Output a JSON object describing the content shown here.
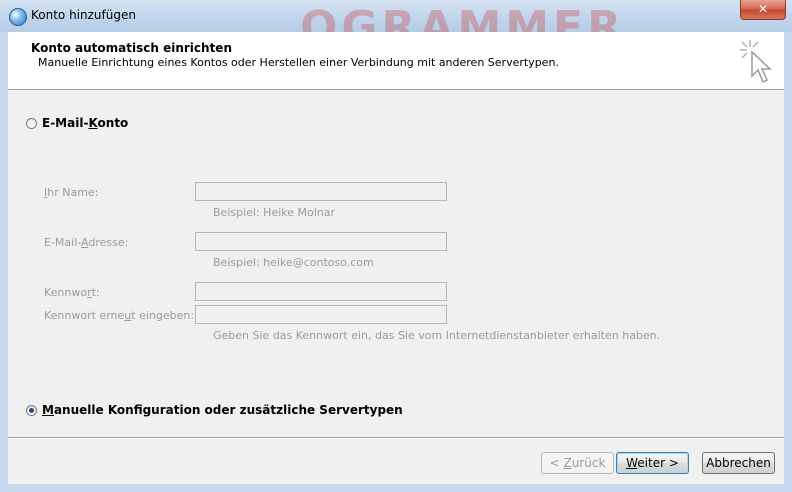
{
  "window": {
    "title": "Konto hinzufügen",
    "background_text": "OGRAMMER",
    "close_symbol": "✕",
    "accent_color": "#c34a30"
  },
  "header": {
    "title": "Konto automatisch einrichten",
    "subtitle": "Manuelle Einrichtung eines Kontos oder Herstellen einer Verbindung mit anderen Servertypen.",
    "icon": "wizard-cursor-icon"
  },
  "options": {
    "email_account": {
      "label_pre": "E-Mail-",
      "label_key": "K",
      "label_post": "onto",
      "selected": false
    },
    "manual_config": {
      "label_key": "M",
      "label_post": "anuelle Konfiguration oder zusätzliche Servertypen",
      "selected": true
    }
  },
  "form": {
    "name": {
      "label_key": "I",
      "label_post": "hr Name:",
      "value": "",
      "hint": "Beispiel: Heike Molnar"
    },
    "email": {
      "label_pre": "E-Mail-",
      "label_key": "A",
      "label_post": "dresse:",
      "value": "",
      "hint": "Beispiel: heike@contoso.com"
    },
    "password": {
      "label_pre": "Kennwo",
      "label_key": "r",
      "label_post": "t:",
      "value": ""
    },
    "password_confirm": {
      "label_pre": "Kennwort erne",
      "label_key": "u",
      "label_post": "t eingeben:",
      "value": "",
      "hint": "Geben Sie das Kennwort ein, das Sie vom Internetdienstanbieter erhalten haben."
    }
  },
  "buttons": {
    "back": {
      "pre": "< ",
      "key": "Z",
      "post": "urück",
      "enabled": false
    },
    "next": {
      "key": "W",
      "post": "eiter >",
      "enabled": true
    },
    "cancel": {
      "label": "Abbrechen",
      "enabled": true
    }
  }
}
